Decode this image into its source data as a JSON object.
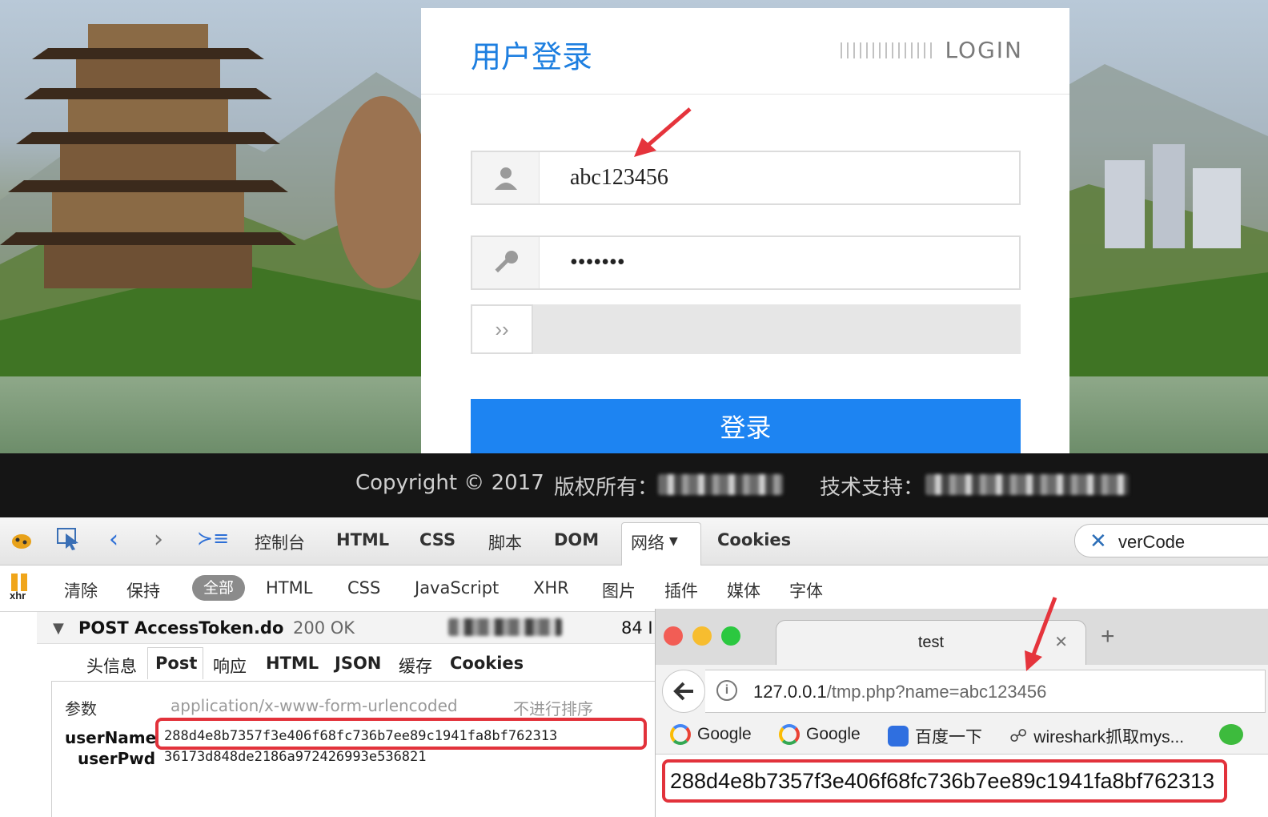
{
  "login": {
    "title": "用户登录",
    "brand": "LOGIN",
    "username_value": "abc123456",
    "password_value": "•••••••",
    "captcha_symbol": "››",
    "submit_label": "登录"
  },
  "footer": {
    "copyright": "Copyright © 2017",
    "rights_label": "版权所有：",
    "support_label": "技术支持："
  },
  "firebug": {
    "toolbar": [
      "控制台",
      "HTML",
      "CSS",
      "脚本",
      "DOM",
      "网络",
      "Cookies"
    ],
    "search_value": "verCode",
    "net_filters": {
      "clear": "清除",
      "persist": "保持",
      "all": "全部",
      "types": [
        "HTML",
        "CSS",
        "JavaScript",
        "XHR",
        "图片",
        "插件",
        "媒体",
        "字体"
      ]
    },
    "xhr_label": "xhr",
    "request": {
      "method_url": "POST AccessToken.do",
      "status": "200 OK",
      "size": "84 I",
      "tabs": [
        "头信息",
        "Post",
        "响应",
        "HTML",
        "JSON",
        "缓存",
        "Cookies"
      ],
      "params_label": "参数",
      "content_type": "application/x-www-form-urlencoded",
      "sort_label": "不进行排序",
      "params": [
        {
          "name": "userName",
          "value": "288d4e8b7357f3e406f68fc736b7ee89c1941fa8bf762313"
        },
        {
          "name": "userPwd",
          "value": "36173d848de2186a972426993e536821"
        }
      ]
    }
  },
  "browser": {
    "tab_title": "test",
    "url_host": "127.0.0.1",
    "url_path": "/tmp.php?name=abc123456",
    "bookmarks": [
      "Google",
      "Google",
      "百度一下",
      "wireshark抓取mys..."
    ],
    "page_output": "288d4e8b7357f3e406f68fc736b7ee89c1941fa8bf762313"
  },
  "colors": {
    "accent_blue": "#1d84f2",
    "highlight_red": "#e2323b",
    "arrow_red": "#e5343c"
  }
}
